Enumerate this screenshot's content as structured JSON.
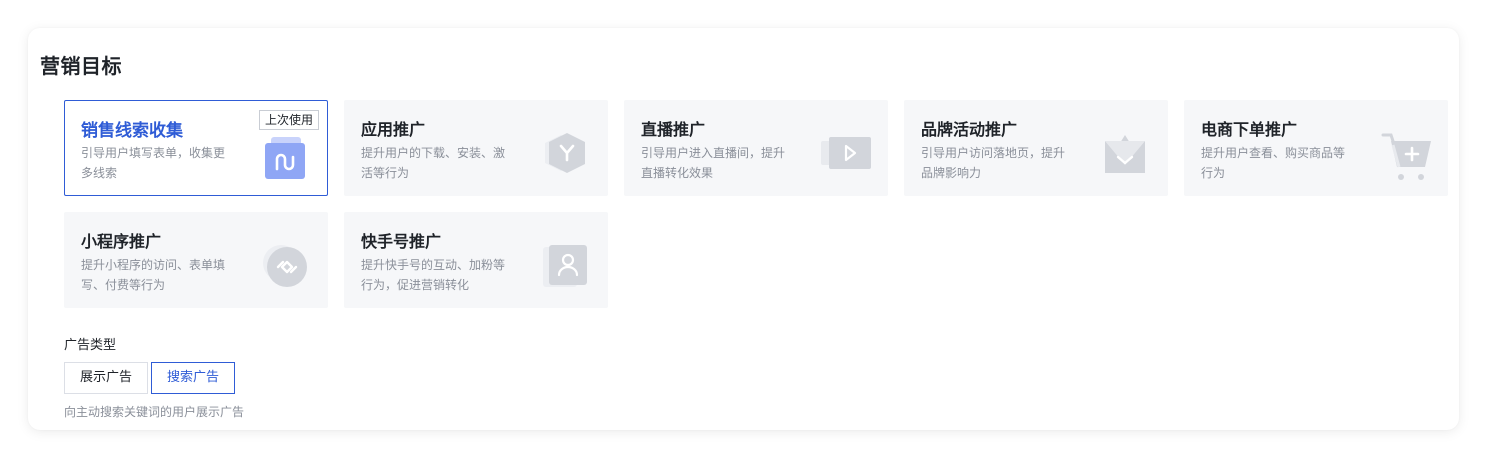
{
  "section_title": "营销目标",
  "cards": [
    {
      "title": "销售线索收集",
      "desc": "引导用户填写表单，收集更多线索",
      "badge": "上次使用",
      "icon": "folder-icon",
      "selected": true
    },
    {
      "title": "应用推广",
      "desc": "提升用户的下载、安装、激活等行为",
      "icon": "hexagon-app-icon"
    },
    {
      "title": "直播推广",
      "desc": "引导用户进入直播间，提升直播转化效果",
      "icon": "video-camera-icon"
    },
    {
      "title": "品牌活动推广",
      "desc": "引导用户访问落地页，提升品牌影响力",
      "icon": "crown-icon"
    },
    {
      "title": "电商下单推广",
      "desc": "提升用户查看、购买商品等行为",
      "icon": "shopping-cart-icon"
    },
    {
      "title": "小程序推广",
      "desc": "提升小程序的访问、表单填写、付费等行为",
      "icon": "mini-program-icon"
    },
    {
      "title": "快手号推广",
      "desc": "提升快手号的互动、加粉等行为，促进营销转化",
      "icon": "user-profile-icon"
    }
  ],
  "ad_type": {
    "label": "广告类型",
    "options": [
      "展示广告",
      "搜索广告"
    ],
    "selected": "搜索广告",
    "hint": "向主动搜索关键词的用户展示广告"
  },
  "colors": {
    "accent": "#2f5cd6",
    "card_bg": "#f6f7f9",
    "muted_text": "#8a8f99"
  }
}
